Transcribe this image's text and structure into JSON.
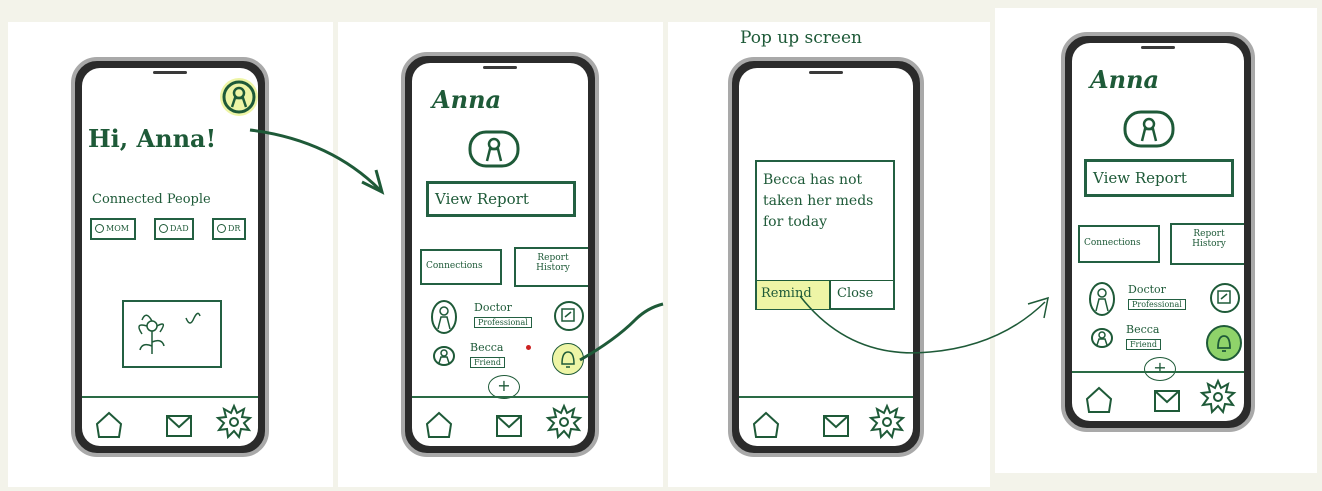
{
  "screen1": {
    "greeting": "Hi, Anna!",
    "connected_heading": "Connected People",
    "people": [
      "MOM",
      "DAD",
      "DR"
    ]
  },
  "screen2": {
    "name": "Anna",
    "view_report": "View Report",
    "connections": "Connections",
    "report_history": "Report History",
    "contacts": [
      {
        "name": "Doctor",
        "role": "Professional"
      },
      {
        "name": "Becca",
        "role": "Friend"
      }
    ]
  },
  "screen3": {
    "caption": "Pop up screen",
    "popup_message": "Becca has not taken her meds for today",
    "remind_label": "Remind",
    "close_label": "Close"
  },
  "screen4": {
    "name": "Anna",
    "view_report": "View Report",
    "connections": "Connections",
    "report_history": "Report History",
    "contacts": [
      {
        "name": "Doctor",
        "role": "Professional"
      },
      {
        "name": "Becca",
        "role": "Friend"
      }
    ]
  },
  "colors": {
    "ink": "#1e5a38",
    "highlight": "#eef5a6",
    "bell_active": "#8fd36a"
  }
}
